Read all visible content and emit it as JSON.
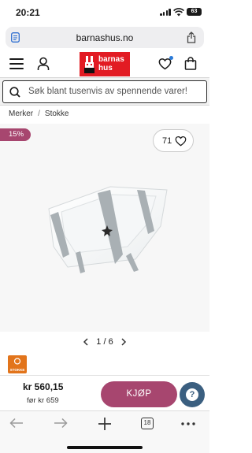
{
  "status": {
    "time": "20:21",
    "battery": "63"
  },
  "browser": {
    "url": "barnashus.no",
    "tab_count": "18"
  },
  "site": {
    "logo_text_line1": "barnas",
    "logo_text_line2": "hus",
    "search_placeholder": "Søk blant tusenvis av spennende varer!",
    "brand_color": "#e21b23"
  },
  "breadcrumb": {
    "items": [
      "Merker",
      "Stokke"
    ],
    "separator": "/"
  },
  "product": {
    "discount_badge": "15%",
    "wishlist_count": "71",
    "image_position": "1 / 6",
    "brand_logo_label": "STOKKE",
    "price": "kr 560,15",
    "before_price": "før kr 659",
    "buy_label": "KJØP",
    "accent_color": "#a7466f"
  },
  "help": {
    "label": "?"
  }
}
